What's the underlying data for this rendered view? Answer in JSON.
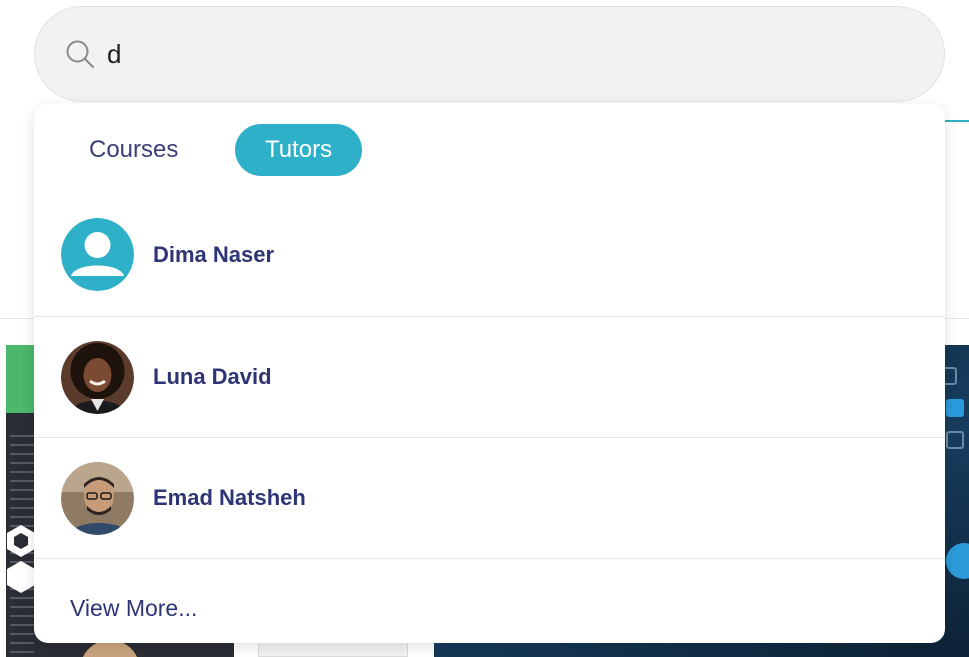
{
  "search": {
    "value": "d",
    "icon": "search-icon"
  },
  "dropdown": {
    "tabs": [
      {
        "label": "Courses",
        "active": false
      },
      {
        "label": "Tutors",
        "active": true
      }
    ],
    "tutors": [
      {
        "name": "Dima Naser",
        "avatar": "default-user-icon"
      },
      {
        "name": "Luna David",
        "avatar": "photo"
      },
      {
        "name": "Emad Natsheh",
        "avatar": "photo"
      }
    ],
    "view_more_label": "View More..."
  },
  "colors": {
    "accent": "#2fb0c9",
    "text_primary": "#2e3575",
    "tab_inactive": "#3a3f7a"
  }
}
